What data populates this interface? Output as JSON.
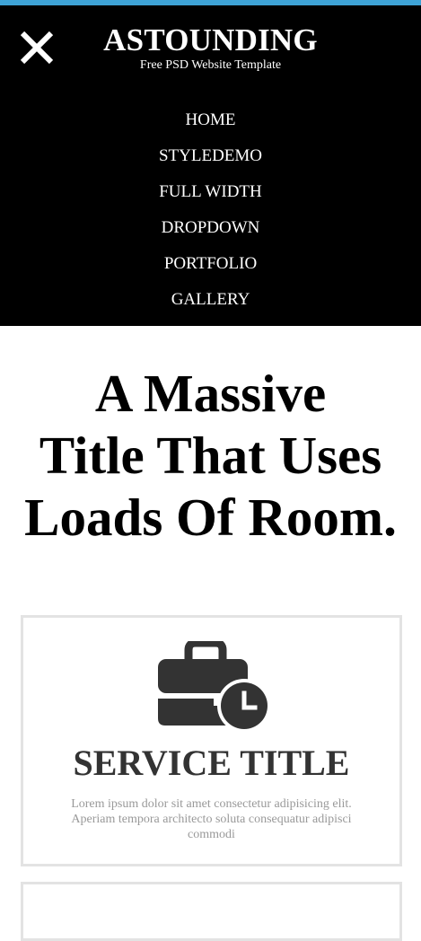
{
  "brand": {
    "title": "ASTOUNDING",
    "tagline": "Free PSD Website Template"
  },
  "nav": {
    "items": [
      "HOME",
      "STYLEDEMO",
      "FULL WIDTH",
      "DROPDOWN",
      "PORTFOLIO",
      "GALLERY"
    ]
  },
  "hero": {
    "line1": "A Massive",
    "line2": "Title That Uses",
    "line3": "Loads Of Room."
  },
  "service": {
    "icon": "briefcase-clock-icon",
    "title": "SERVICE TITLE",
    "text": "Lorem ipsum dolor sit amet consectetur adipisicing elit. Aperiam tempora architecto soluta consequatur adipisci commodi"
  },
  "colors": {
    "accent": "#3ea3d6",
    "header_bg": "#000000",
    "card_border": "#e3e3e3",
    "title_text": "#333333",
    "body_text": "#999999"
  }
}
